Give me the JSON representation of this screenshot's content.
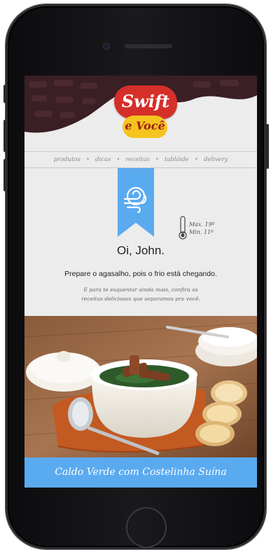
{
  "brand": {
    "name": "Swift",
    "tagline": "e Você"
  },
  "nav": {
    "items": [
      {
        "label": "produtos"
      },
      {
        "label": "dicas"
      },
      {
        "label": "receitas"
      },
      {
        "label": "tablóide"
      },
      {
        "label": "delivery"
      }
    ],
    "separator": "•"
  },
  "weather": {
    "icon": "thermometer-icon",
    "badge_icon": "wind-icon",
    "max": "Max. 19º",
    "min": "Min. 11º"
  },
  "greeting": "Oi, John.",
  "subtitle": "Prepare o agasalho, pois o frio está chegando.",
  "note_line1": "E para te esquentar ainda mais, confira as",
  "note_line2": "receitas deliciosas que separamos pra você.",
  "recipe": {
    "title": "Caldo Verde com Costelinha Suína"
  },
  "colors": {
    "accent_blue": "#5aaaf0",
    "brand_red": "#d52f2a",
    "brand_yellow": "#f5c41f",
    "header_dark": "#3a1f24"
  }
}
